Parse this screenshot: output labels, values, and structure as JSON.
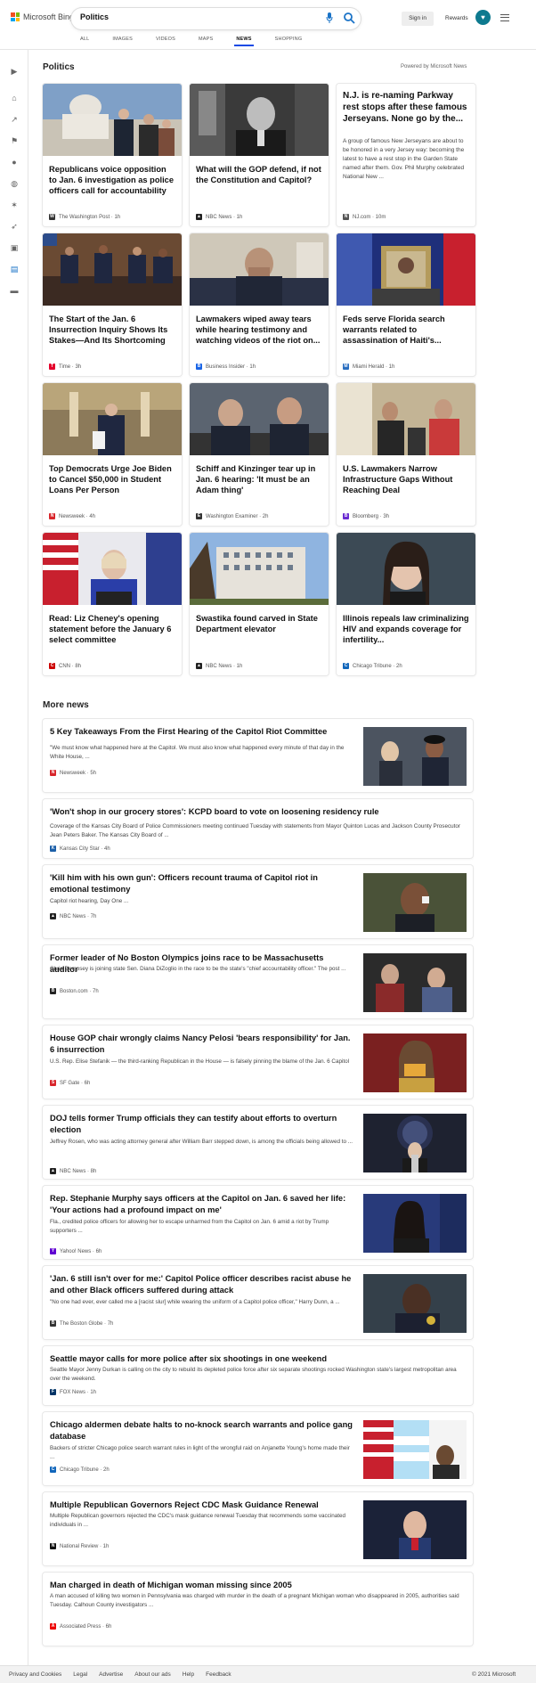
{
  "header": {
    "brand": "Microsoft Bing",
    "search_value": "Politics",
    "signin_label": "Sign in",
    "rewards_label": "Rewards",
    "tabs": [
      {
        "label": "ALL"
      },
      {
        "label": "IMAGES"
      },
      {
        "label": "VIDEOS"
      },
      {
        "label": "MAPS"
      },
      {
        "label": "NEWS",
        "active": true
      },
      {
        "label": "SHOPPING"
      }
    ]
  },
  "sidebar": {
    "icons": [
      "chevron-right-icon",
      "home-icon",
      "trending-icon",
      "flag-icon",
      "location-icon",
      "globe-icon",
      "bulb-icon",
      "rocket-icon",
      "entertainment-icon",
      "bank-icon",
      "money-icon"
    ]
  },
  "top": {
    "title": "Politics",
    "powered": "Powered by Microsoft News",
    "cards": [
      {
        "title": "Republicans voice opposition to Jan. 6 investigation as police officers call for accountability",
        "source": "The Washington Post · 1h"
      },
      {
        "title": "What will the GOP defend, if not the Constitution and Capitol?",
        "source": "NBC News · 1h"
      },
      {
        "title": "N.J. is re-naming Parkway rest stops after these famous Jerseyans. None go by the...",
        "desc": "A group of famous New Jerseyans are about to be honored in a very Jersey way: becoming the latest to have a rest stop in the Garden State named after them. Gov. Phil Murphy celebrated National New ...",
        "source": "NJ.com · 10m"
      },
      {
        "title": "The Start of the Jan. 6 Insurrection Inquiry Shows Its Stakes—And Its Shortcoming",
        "source": "Time · 3h"
      },
      {
        "title": "Lawmakers wiped away tears while hearing testimony and watching videos of the riot on...",
        "source": "Business Insider · 1h"
      },
      {
        "title": "Feds serve Florida search warrants related to assassination of Haiti's...",
        "source": "Miami Herald · 1h"
      },
      {
        "title": "Top Democrats Urge Joe Biden to Cancel $50,000 in Student Loans Per Person",
        "source": "Newsweek · 4h"
      },
      {
        "title": "Schiff and Kinzinger tear up in Jan. 6 hearing: 'It must be an Adam thing'",
        "source": "Washington Examiner · 2h"
      },
      {
        "title": "U.S. Lawmakers Narrow Infrastructure Gaps Without Reaching Deal",
        "source": "Bloomberg · 3h"
      },
      {
        "title": "Read: Liz Cheney's opening statement before the January 6 select committee",
        "source": "CNN · 8h"
      },
      {
        "title": "Swastika found carved in State Department elevator",
        "source": "NBC News · 1h"
      },
      {
        "title": "Illinois repeals law criminalizing HIV and expands coverage for infertility...",
        "source": "Chicago Tribune · 2h"
      }
    ]
  },
  "more": {
    "title": "More news",
    "items": [
      {
        "title": "5 Key Takeaways From the First Hearing of the Capitol Riot Committee",
        "desc": "\"We must know what happened here at the Capitol. We must also know what happened every minute of that day in the White House, ...",
        "source": "Newsweek · 5h"
      },
      {
        "title": "'Won't shop in our grocery stores': KCPD board to vote on loosening residency rule",
        "desc": "Coverage of the Kansas City Board of Police Commissioners meeting continued Tuesday with statements from Mayor Quinton Lucas and Jackson County Prosecutor Jean Peters Baker. The Kansas City Board of ...",
        "source": "Kansas City Star · 4h"
      },
      {
        "title": "'Kill him with his own gun': Officers recount trauma of Capitol riot in emotional testimony",
        "desc": "Capitol riot hearing, Day One ...",
        "source": "NBC News · 7h"
      },
      {
        "title": "Former leader of No Boston Olympics joins race to be Massachusetts auditor",
        "desc": "Chris Dempsey is joining state Sen. Diana DiZoglio in the race to be the state's \"chief accountability officer.\" The post ...",
        "source": "Boston.com · 7h"
      },
      {
        "title": "House GOP chair wrongly claims Nancy Pelosi 'bears responsibility' for Jan. 6 insurrection",
        "desc": "U.S. Rep. Elise Stefanik — the third-ranking Republican in the House — is falsely pinning the blame of the Jan. 6 Capitol",
        "source": "SF Gate · 6h"
      },
      {
        "title": "DOJ tells former Trump officials they can testify about efforts to overturn election",
        "desc": "Jeffrey Rosen, who was acting attorney general after William Barr stepped down, is among the officials being allowed to ...",
        "source": "NBC News · 8h"
      },
      {
        "title": "Rep. Stephanie Murphy says officers at the Capitol on Jan. 6 saved her life: 'Your actions had a profound impact on me'",
        "desc": "Fla., credited police officers for allowing her to escape unharmed from the Capitol on Jan. 6 amid a riot by Trump supporters ...",
        "source": "Yahoo! News · 6h"
      },
      {
        "title": "'Jan. 6 still isn't over for me:' Capitol Police officer describes racist abuse he and other Black officers suffered during attack",
        "desc": "\"No one had ever, ever called me a [racist slur] while wearing the uniform of a Capitol police officer,\" Harry Dunn, a ...",
        "source": "The Boston Globe · 7h"
      },
      {
        "title": "Seattle mayor calls for more police after six shootings in one weekend",
        "desc": "Seattle Mayor Jenny Durkan is calling on the city to rebuild its depleted police force after six separate shootings rocked Washington state's largest metropolitan area over the weekend.",
        "source": "FOX News · 1h"
      },
      {
        "title": "Chicago aldermen debate halts to no-knock search warrants and police gang database",
        "desc": "Backers of stricter Chicago police search warrant rules in light of the wrongful raid on Anjanette Young's home made their ...",
        "source": "Chicago Tribune · 2h"
      },
      {
        "title": "Multiple Republican Governors Reject CDC Mask Guidance Renewal",
        "desc": "Multiple Republican governors rejected the CDC's mask guidance renewal Tuesday that recommends some vaccinated individuals in ...",
        "source": "National Review · 1h"
      },
      {
        "title": "Man charged in death of Michigan woman missing since 2005",
        "desc": "A man accused of killing two women in Pennsylvania was charged with murder in the death of a pregnant Michigan woman who disappeared in 2005, authorities said Tuesday. Calhoun County investigators ...",
        "source": "Associated Press · 6h"
      }
    ]
  },
  "footer": {
    "links": [
      "Privacy and Cookies",
      "Legal",
      "Advertise",
      "About our ads",
      "Help",
      "Feedback"
    ],
    "copyright": "© 2021 Microsoft"
  }
}
